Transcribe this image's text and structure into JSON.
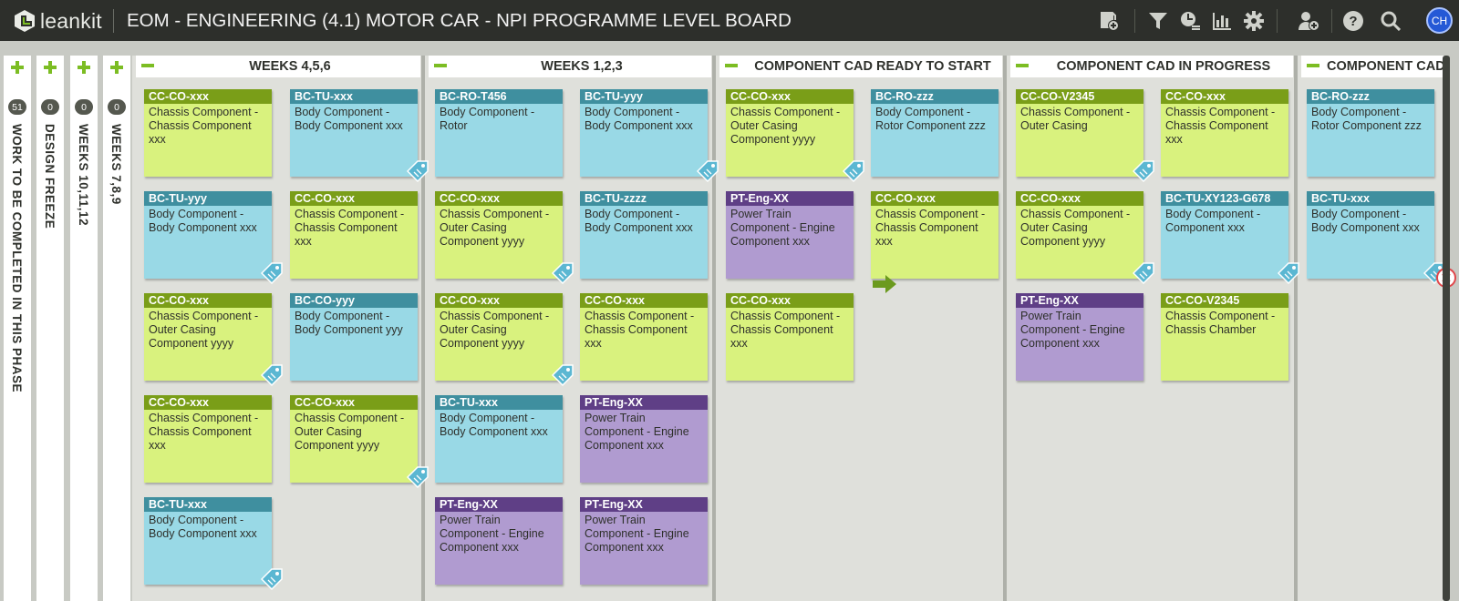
{
  "app": {
    "logo_text": "leankit",
    "board_title": "EOM - ENGINEERING (4.1) MOTOR CAR - NPI PROGRAMME LEVEL BOARD",
    "avatar": "CH"
  },
  "toolbar": [
    {
      "icon": "add-card-icon"
    },
    {
      "icon": "filter-icon"
    },
    {
      "icon": "activity-clock-icon"
    },
    {
      "icon": "reports-chart-icon"
    },
    {
      "icon": "settings-gear-icon"
    },
    {
      "icon": "add-user-icon"
    },
    {
      "icon": "help-icon"
    },
    {
      "icon": "search-icon"
    }
  ],
  "collapsed_lanes": [
    {
      "count": "51",
      "label": "WORK TO BE COMPLETED IN THIS PHASE"
    },
    {
      "count": "0",
      "label": "DESIGN FREEZE"
    },
    {
      "count": "0",
      "label": "WEEKS 10,11,12"
    },
    {
      "count": "0",
      "label": "WEEKS 7,8,9"
    }
  ],
  "lanes": [
    {
      "title": "WEEKS 4,5,6"
    },
    {
      "title": "WEEKS 1,2,3"
    },
    {
      "title": "COMPONENT CAD READY TO START"
    },
    {
      "title": "COMPONENT CAD IN PROGRESS"
    },
    {
      "title": "COMPONENT CAD"
    }
  ],
  "cards": [
    {
      "id": "CC-CO-xxx",
      "text": "Chassis Component - Chassis Component xxx",
      "type": "green"
    },
    {
      "id": "BC-TU-xxx",
      "text": "Body Component - Body Component xxx",
      "type": "blue",
      "tag": true
    },
    {
      "id": "BC-TU-yyy",
      "text": "Body Component - Body Component xxx",
      "type": "blue",
      "tag": true
    },
    {
      "id": "CC-CO-xxx",
      "text": "Chassis Component - Chassis Component xxx",
      "type": "green"
    },
    {
      "id": "CC-CO-xxx",
      "text": "Chassis Component - Outer Casing Component yyyy",
      "type": "green",
      "tag": true
    },
    {
      "id": "BC-CO-yyy",
      "text": "Body Component - Body Component yyy",
      "type": "blue"
    },
    {
      "id": "CC-CO-xxx",
      "text": "Chassis Component - Chassis Component xxx",
      "type": "green"
    },
    {
      "id": "CC-CO-xxx",
      "text": "Chassis Component - Outer Casing Component yyyy",
      "type": "green",
      "tag": true
    },
    {
      "id": "BC-TU-xxx",
      "text": "Body Component - Body Component xxx",
      "type": "blue",
      "tag": true
    },
    {
      "id": "BC-RO-T456",
      "text": "Body Component - Rotor",
      "type": "blue"
    },
    {
      "id": "BC-TU-yyy",
      "text": "Body Component - Body Component xxx",
      "type": "blue",
      "tag": true
    },
    {
      "id": "CC-CO-xxx",
      "text": "Chassis Component - Outer Casing Component yyyy",
      "type": "green",
      "tag": true
    },
    {
      "id": "BC-TU-zzzz",
      "text": "Body Component - Body Component xxx",
      "type": "blue"
    },
    {
      "id": "CC-CO-xxx",
      "text": "Chassis Component - Outer Casing Component yyyy",
      "type": "green",
      "tag": true
    },
    {
      "id": "CC-CO-xxx",
      "text": "Chassis Component - Chassis Component xxx",
      "type": "green"
    },
    {
      "id": "BC-TU-xxx",
      "text": "Body Component - Body Component xxx",
      "type": "blue"
    },
    {
      "id": "PT-Eng-XX",
      "text": "Power Train Component - Engine Component xxx",
      "type": "purple"
    },
    {
      "id": "PT-Eng-XX",
      "text": "Power Train Component - Engine Component xxx",
      "type": "purple"
    },
    {
      "id": "PT-Eng-XX",
      "text": "Power Train Component - Engine Component xxx",
      "type": "purple"
    },
    {
      "id": "CC-CO-xxx",
      "text": "Chassis Component - Outer Casing Component yyyy",
      "type": "green",
      "tag": true
    },
    {
      "id": "BC-RO-zzz",
      "text": "Body Component - Rotor Component zzz",
      "type": "blue"
    },
    {
      "id": "PT-Eng-XX",
      "text": "Power Train Component - Engine Component xxx",
      "type": "purple"
    },
    {
      "id": "CC-CO-xxx",
      "text": "Chassis Component - Chassis Component xxx",
      "type": "green",
      "arrow": true
    },
    {
      "id": "CC-CO-xxx",
      "text": "Chassis Component - Chassis Component xxx",
      "type": "green"
    },
    {
      "id": "CC-CO-V2345",
      "text": "Chassis Component - Outer Casing",
      "type": "green",
      "tag": true
    },
    {
      "id": "CC-CO-xxx",
      "text": "Chassis Component - Chassis Component xxx",
      "type": "green"
    },
    {
      "id": "CC-CO-xxx",
      "text": "Chassis Component - Outer Casing Component yyyy",
      "type": "green",
      "tag": true
    },
    {
      "id": "BC-TU-XY123-G678",
      "text": "Body Component - Component xxx",
      "type": "blue",
      "tag": true
    },
    {
      "id": "PT-Eng-XX",
      "text": "Power Train Component - Engine Component xxx",
      "type": "purple"
    },
    {
      "id": "CC-CO-V2345",
      "text": "Chassis Component - Chassis Chamber",
      "type": "green"
    },
    {
      "id": "BC-RO-zzz",
      "text": "Body Component - Rotor Component zzz",
      "type": "blue"
    },
    {
      "id": "BC-TU-xxx",
      "text": "Body Component - Body Component xxx",
      "type": "blue",
      "tag": true,
      "blocked": true
    }
  ]
}
